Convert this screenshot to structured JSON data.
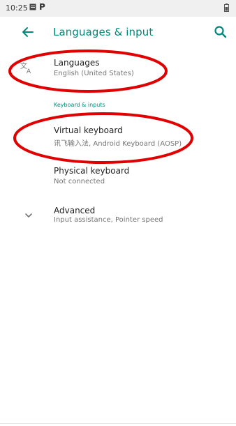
{
  "status_bar": {
    "time": "10:25",
    "icons": [
      "image-icon",
      "p-icon",
      "battery-icon"
    ],
    "p_glyph": "P"
  },
  "app_bar": {
    "title": "Languages & input",
    "back_icon": "arrow-left-icon",
    "search_icon": "search-icon"
  },
  "settings": {
    "languages": {
      "title": "Languages",
      "summary": "English (United States)",
      "icon": "translate-icon"
    },
    "section_header": "Keyboard & inputs",
    "virtual_keyboard": {
      "title": "Virtual keyboard",
      "summary": "讯飞输入法, Android Keyboard (AOSP)"
    },
    "physical_keyboard": {
      "title": "Physical keyboard",
      "summary": "Not connected"
    },
    "advanced": {
      "title": "Advanced",
      "summary": "Input assistance, Pointer speed",
      "icon": "chevron-down-icon"
    }
  },
  "annotations": {
    "color": "#e00000",
    "count": 2
  },
  "colors": {
    "accent": "#00897b",
    "title_text": "#212121",
    "summary_text": "#757575"
  }
}
